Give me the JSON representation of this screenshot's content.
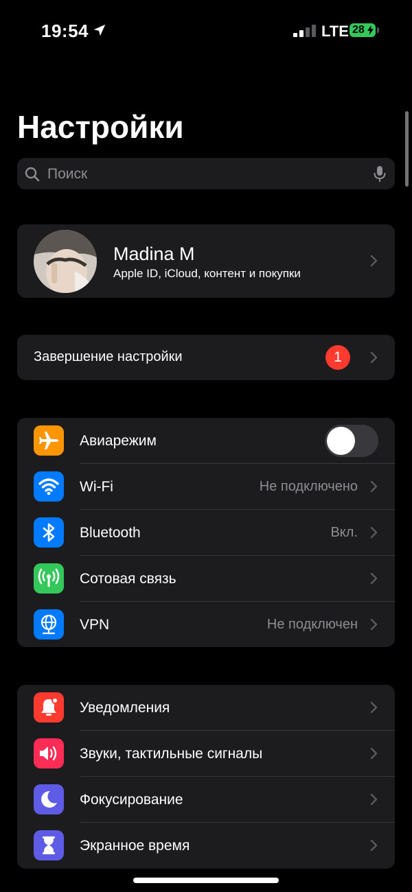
{
  "status": {
    "time": "19:54",
    "network": "LTE",
    "battery": "28"
  },
  "title": "Настройки",
  "search": {
    "placeholder": "Поиск"
  },
  "profile": {
    "name": "Madina M",
    "subtitle": "Apple ID, iCloud, контент и покупки"
  },
  "setup": {
    "label": "Завершение настройки",
    "badge": "1"
  },
  "connectivity": [
    {
      "label": "Авиарежим",
      "value": "",
      "icon": "airplane-icon",
      "color": "#ff9500",
      "toggle": false
    },
    {
      "label": "Wi-Fi",
      "value": "Не подключено",
      "icon": "wifi-icon",
      "color": "#007aff"
    },
    {
      "label": "Bluetooth",
      "value": "Вкл.",
      "icon": "bluetooth-icon",
      "color": "#007aff"
    },
    {
      "label": "Сотовая связь",
      "value": "",
      "icon": "cellular-icon",
      "color": "#34c759"
    },
    {
      "label": "VPN",
      "value": "Не подключен",
      "icon": "vpn-icon",
      "color": "#007aff"
    }
  ],
  "notifications": [
    {
      "label": "Уведомления",
      "icon": "bell-icon",
      "color": "#ff3b30"
    },
    {
      "label": "Звуки, тактильные сигналы",
      "icon": "speaker-icon",
      "color": "#ff2d55"
    },
    {
      "label": "Фокусирование",
      "icon": "moon-icon",
      "color": "#5e5ce6"
    },
    {
      "label": "Экранное время",
      "icon": "hourglass-icon",
      "color": "#5e5ce6"
    }
  ]
}
